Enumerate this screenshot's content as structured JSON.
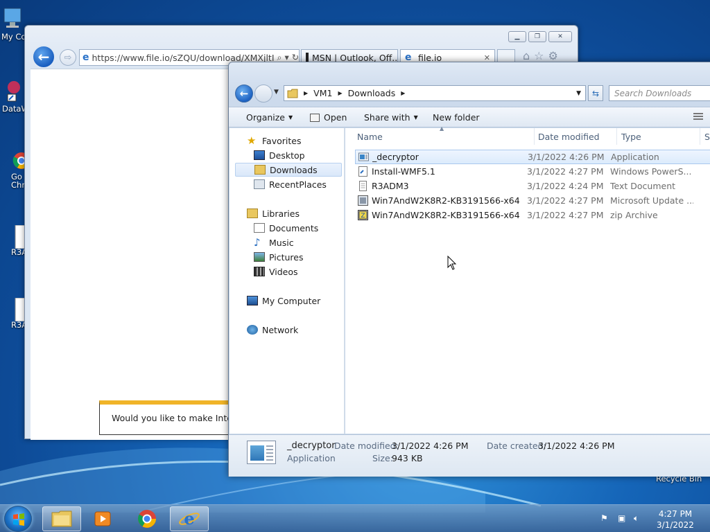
{
  "desktop": {
    "icons": [
      {
        "label": "My Co"
      },
      {
        "label": "DataW"
      },
      {
        "label": "Go"
      },
      {
        "label": "Chr"
      },
      {
        "label": "R3A"
      },
      {
        "label": "R3A"
      }
    ],
    "recycle_bin_label": "Recycle Bin"
  },
  "ie": {
    "address": "https://www.file.io/sZQU/download/XMXjltI",
    "address_tools": "⌕ ▾ ↻",
    "tabs": [
      {
        "label": "MSN | Outlook, Off...",
        "icon": "msn-icon"
      },
      {
        "label": "file.io",
        "icon": "ie-icon",
        "close": "✕"
      }
    ],
    "notification_text": "Would you like to make Internet"
  },
  "explorer": {
    "breadcrumb": [
      "VM1",
      "Downloads"
    ],
    "search_placeholder": "Search Downloads",
    "toolbar": {
      "organize": "Organize",
      "open": "Open",
      "share_with": "Share with",
      "new_folder": "New folder"
    },
    "nav": {
      "favorites_header": "Favorites",
      "favorites": [
        "Desktop",
        "Downloads",
        "RecentPlaces"
      ],
      "libraries_header": "Libraries",
      "libraries": [
        "Documents",
        "Music",
        "Pictures",
        "Videos"
      ],
      "computer": "My Computer",
      "network": "Network"
    },
    "columns": {
      "name": "Name",
      "date": "Date modified",
      "type": "Type",
      "size": "Si"
    },
    "files": [
      {
        "name": "_decryptor",
        "date": "3/1/2022 4:26 PM",
        "type": "Application",
        "icon": "application-icon"
      },
      {
        "name": "Install-WMF5.1",
        "date": "3/1/2022 4:27 PM",
        "type": "Windows PowerS...",
        "icon": "powershell-script-icon"
      },
      {
        "name": "R3ADM3",
        "date": "3/1/2022 4:24 PM",
        "type": "Text Document",
        "icon": "text-document-icon"
      },
      {
        "name": "Win7AndW2K8R2-KB3191566-x64",
        "date": "3/1/2022 4:27 PM",
        "type": "Microsoft Update ...",
        "icon": "update-package-icon"
      },
      {
        "name": "Win7AndW2K8R2-KB3191566-x64",
        "date": "3/1/2022 4:27 PM",
        "type": "zip Archive",
        "icon": "zip-archive-icon"
      }
    ],
    "details": {
      "name": "_decryptor",
      "type": "Application",
      "date_modified_label": "Date modified:",
      "date_modified": "3/1/2022 4:26 PM",
      "size_label": "Size:",
      "size": "943 KB",
      "date_created_label": "Date created:",
      "date_created": "3/1/2022 4:26 PM"
    }
  },
  "taskbar": {
    "clock_time": "4:27 PM",
    "clock_date": "3/1/2022"
  }
}
